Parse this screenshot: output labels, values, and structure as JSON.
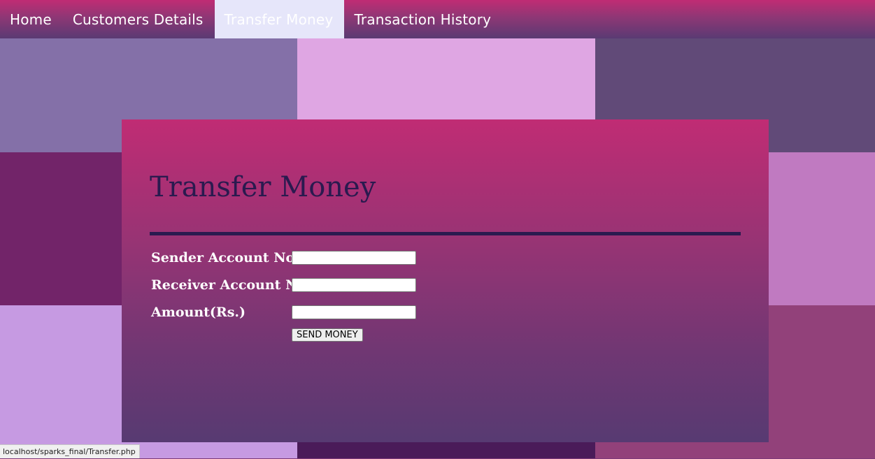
{
  "nav": {
    "items": [
      {
        "label": "Home"
      },
      {
        "label": "Customers Details"
      },
      {
        "label": "Transfer Money",
        "active": true
      },
      {
        "label": "Transaction History"
      }
    ]
  },
  "form": {
    "title": "Transfer Money",
    "sender_label": "Sender Account No",
    "sender_value": "",
    "receiver_label": "Receiver Account No",
    "receiver_value": "",
    "amount_label": "Amount(Rs.)",
    "amount_value": "",
    "submit_label": "SEND MONEY"
  },
  "status_bar": {
    "url": "localhost/sparks_final/Transfer.php"
  },
  "colors": {
    "header_gradient_top": "#c02c74",
    "header_gradient_bottom": "#5a3a73",
    "active_tab_bg": "#e6e6fa",
    "title_color": "#2a1a4f"
  }
}
